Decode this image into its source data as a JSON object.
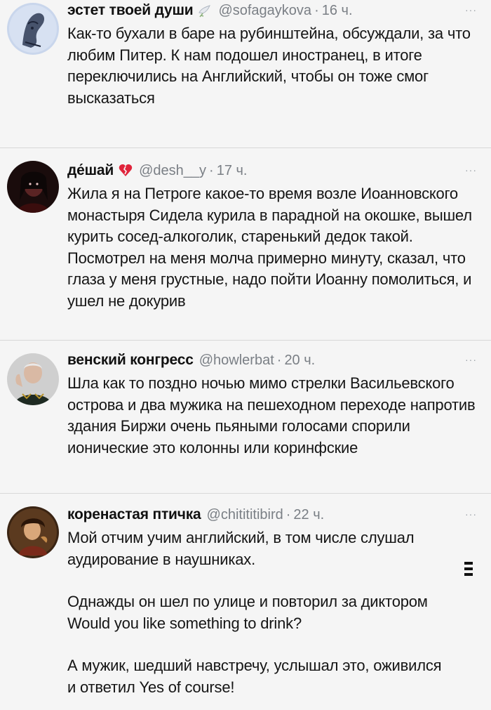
{
  "tweets": [
    {
      "name": "эстет твоей души",
      "emoji": "dove-emoji",
      "handle": "@sofagaykova",
      "dot": "·",
      "time": "16 ч.",
      "more": "···",
      "paragraphs": [
        "Как-то бухали в баре на рубинштейна, обсуждали, за что любим Питер. К нам подошел иностранец, в итоге переключились на Английский, чтобы он тоже смог высказаться"
      ]
    },
    {
      "name": "де́шай",
      "emoji": "broken-heart-emoji",
      "handle": "@desh__y",
      "dot": "·",
      "time": "17 ч.",
      "more": "···",
      "paragraphs": [
        "Жила я на Петроге какое-то время возле Иоанновского монастыря Сидела курила в парадной на окошке, вышел курить сосед-алкоголик, старенький дедок такой. Посмотрел на меня молча примерно минуту, сказал, что глаза у меня грустные, надо пойти Иоанну помолиться, и ушел не докурив"
      ]
    },
    {
      "name": "венский конгресс",
      "emoji": "",
      "handle": "@howlerbat",
      "dot": "·",
      "time": "20 ч.",
      "more": "···",
      "paragraphs": [
        "Шла как то поздно ночью мимо стрелки Васильевского острова и два мужика на пешеходном переходе напротив здания Биржи очень пьяными голосами спорили ионические это колонны или коринфские"
      ]
    },
    {
      "name": "коренастая птичка",
      "emoji": "",
      "handle": "@chitititibird",
      "dot": "·",
      "time": "22 ч.",
      "more": "···",
      "paragraphs": [
        "Мой отчим учим английский, в том числе слушал аудирование в наушниках.",
        "Однажды он шел по улице и повторил за диктором Would you like something to drink?",
        "А мужик, шедший навстречу, услышал это, оживился и ответил Yes of course!"
      ]
    }
  ]
}
